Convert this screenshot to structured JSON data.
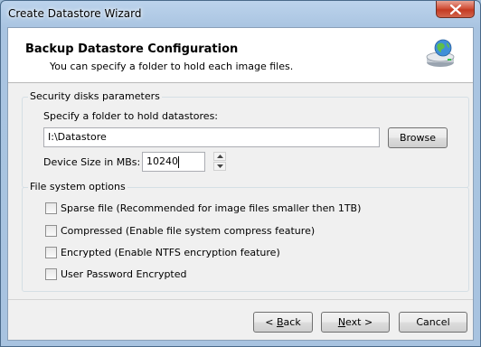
{
  "window": {
    "title": "Create Datastore Wizard",
    "close_symbol": "✕"
  },
  "header": {
    "title": "Backup Datastore Configuration",
    "subtitle": "You can specify a folder to hold each image files.",
    "icon": "disk-globe-icon"
  },
  "security_group": {
    "legend": "Security disks parameters",
    "folder_label": "Specify a folder to hold datastores:",
    "folder_value": "I:\\Datastore",
    "browse_label": "Browse",
    "size_label": "Device Size in MBs:",
    "size_value": "10240"
  },
  "fs_group": {
    "legend": "File system options",
    "options": [
      {
        "label": "Sparse file (Recommended for image files smaller then 1TB)",
        "checked": false
      },
      {
        "label": "Compressed (Enable file system compress feature)",
        "checked": false
      },
      {
        "label": "Encrypted (Enable NTFS encryption feature)",
        "checked": false
      },
      {
        "label": "User Password Encrypted",
        "checked": false
      }
    ]
  },
  "footer": {
    "back_prefix": "< ",
    "back_accel": "B",
    "back_rest": "ack",
    "next_accel": "N",
    "next_rest": "ext >",
    "cancel_label": "Cancel"
  },
  "colors": {
    "title_bar": "#a9c4e1",
    "close_button": "#c43b23",
    "dialog_background": "#f0f0f0",
    "header_background": "#ffffff"
  }
}
